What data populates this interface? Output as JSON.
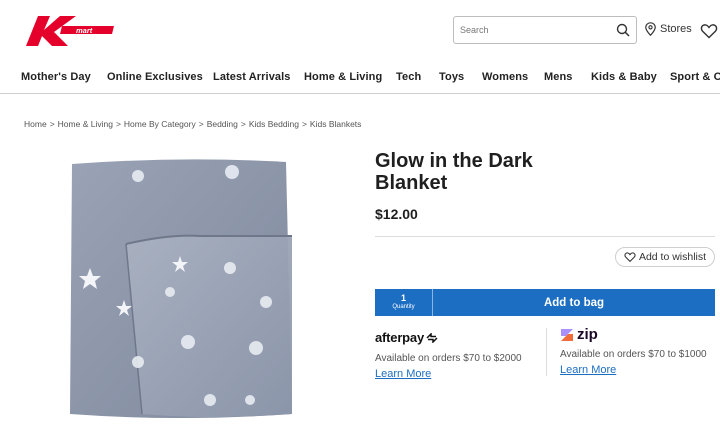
{
  "header": {
    "logo_text": "kmart",
    "search": {
      "placeholder": "Search"
    },
    "stores_label": "Stores"
  },
  "nav": {
    "items": [
      {
        "label": "Mother's Day"
      },
      {
        "label": "Online Exclusives"
      },
      {
        "label": "Latest Arrivals"
      },
      {
        "label": "Home & Living"
      },
      {
        "label": "Tech"
      },
      {
        "label": "Toys"
      },
      {
        "label": "Womens"
      },
      {
        "label": "Mens"
      },
      {
        "label": "Kids & Baby"
      },
      {
        "label": "Sport & Ou"
      }
    ]
  },
  "breadcrumb": [
    {
      "label": "Home"
    },
    {
      "label": "Home & Living"
    },
    {
      "label": "Home By Category"
    },
    {
      "label": "Bedding"
    },
    {
      "label": "Kids Bedding"
    },
    {
      "label": "Kids Blankets"
    }
  ],
  "breadcrumb_separator": ">",
  "product": {
    "title_line1": "Glow in the Dark",
    "title_line2": "Blanket",
    "price": "$12.00",
    "wishlist_label": "Add to wishlist",
    "quantity": "1",
    "quantity_label": "Quantity",
    "add_to_bag_label": "Add to bag"
  },
  "payment": {
    "afterpay": {
      "brand": "afterpay",
      "text": "Available on orders $70 to $2000",
      "learn_more": "Learn More"
    },
    "zip": {
      "brand": "zip",
      "text": "Available on orders $70 to $1000",
      "learn_more": "Learn More"
    }
  },
  "colors": {
    "brand_red": "#e4002b",
    "accent_blue": "#1c6ec2",
    "zip_purple": "#1a0826",
    "zip_orange": "#f26b3a",
    "blanket_gray": "#8e98ab"
  }
}
